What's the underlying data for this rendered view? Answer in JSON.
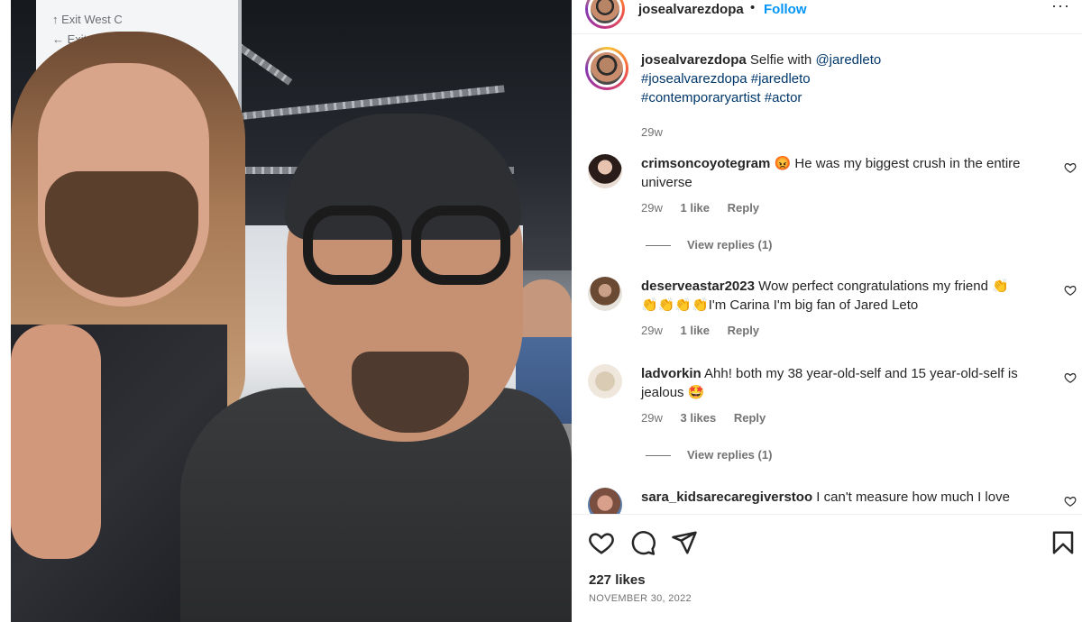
{
  "post": {
    "username": "josealvarezdopa",
    "separator": "•",
    "follow_label": "Follow",
    "more_label": "···",
    "caption_text": "Selfie with",
    "caption_mention": "@jaredleto",
    "caption_tags_line1": "#josealvarezdopa #jaredleto",
    "caption_tags_line2": "#contemporaryartist #actor",
    "caption_age": "29w",
    "likes": "227 likes",
    "date": "NOVEMBER 30, 2022"
  },
  "photo": {
    "sign_line1": "↑ Exit West C",
    "sign_line2": "← Exit East C"
  },
  "comments": [
    {
      "username": "crimsoncoyotegram",
      "text_line1": "😡 He was my biggest crush in the entire",
      "text_line2": "universe",
      "age": "29w",
      "likes": "1 like",
      "reply": "Reply",
      "view_replies": "View replies (1)"
    },
    {
      "username": "deserveastar2023",
      "text_line1": "Wow perfect congratulations my friend 👏",
      "text_line2": "👏👏👏👏I'm Carina I'm big fan of Jared Leto",
      "age": "29w",
      "likes": "1 like",
      "reply": "Reply"
    },
    {
      "username": "ladvorkin",
      "text_line1": "Ahh! both my 38 year-old-self and 15 year-old-self is",
      "text_line2": "jealous 🤩",
      "age": "29w",
      "likes": "3 likes",
      "reply": "Reply",
      "view_replies": "View replies (1)"
    },
    {
      "username": "sara_kidsarecaregiverstoo",
      "text_line1": "I can't measure how much I love"
    }
  ],
  "icons": {
    "like": "heart-icon",
    "comment": "comment-icon",
    "share": "send-icon",
    "save": "bookmark-icon",
    "comment_like": "small-heart-icon"
  },
  "colors": {
    "accent": "#0095f6",
    "hashtag": "#00376b",
    "muted": "#737373",
    "text": "#262626"
  }
}
